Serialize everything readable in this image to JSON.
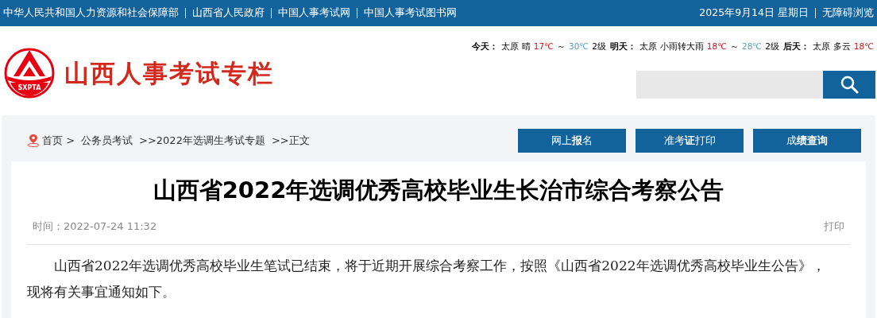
{
  "top_bar": {
    "links": [
      "中华人民共和国人力资源和社会保障部",
      "山西省人民政府",
      "中国人事考试网",
      "中国人事考试图书网"
    ],
    "date": "2025年9月14日 星期日",
    "accessibility": "无障碍浏览"
  },
  "header": {
    "logo_mark": "SXPTA",
    "site_title": "山西人事考试专栏",
    "weather": [
      {
        "items": [
          {
            "kind": "label",
            "text": "今天："
          },
          {
            "kind": "text",
            "text": "太原"
          },
          {
            "kind": "text",
            "text": "晴"
          },
          {
            "kind": "low",
            "text": "17℃"
          },
          {
            "kind": "sep",
            "text": "～"
          },
          {
            "kind": "high",
            "text": "30℃"
          },
          {
            "kind": "text",
            "text": "2级"
          }
        ]
      },
      {
        "items": [
          {
            "kind": "label",
            "text": "明天："
          },
          {
            "kind": "text",
            "text": "太原"
          },
          {
            "kind": "text",
            "text": "小雨转大雨"
          },
          {
            "kind": "low",
            "text": "18℃"
          },
          {
            "kind": "sep",
            "text": "～"
          },
          {
            "kind": "high",
            "text": "28℃"
          },
          {
            "kind": "text",
            "text": "2级"
          }
        ]
      },
      {
        "items": [
          {
            "kind": "label",
            "text": "后天："
          },
          {
            "kind": "text",
            "text": "太原"
          },
          {
            "kind": "text",
            "text": "多云"
          },
          {
            "kind": "low",
            "text": "18℃"
          }
        ]
      }
    ]
  },
  "breadcrumb": [
    "首页 >",
    "公务员考试",
    ">>2022年选调生考试专题",
    ">>正文"
  ],
  "buttons": [
    "网上**报**名",
    "准考**证**打印",
    "成**绩查询**"
  ],
  "article": {
    "title": "山西省2022年选调优秀高校毕业生长治市综合考察公告",
    "time_label": "时间：",
    "time": "2022-07-24 11:32",
    "print": "打印",
    "paragraphs": [
      "山西省2022年选调优秀高校毕业生笔试已结束，将于近期开展综合考察工作，按照《山西省2022年选调优秀高校毕业生公告》，现将有关事宜通知如下。"
    ]
  }
}
